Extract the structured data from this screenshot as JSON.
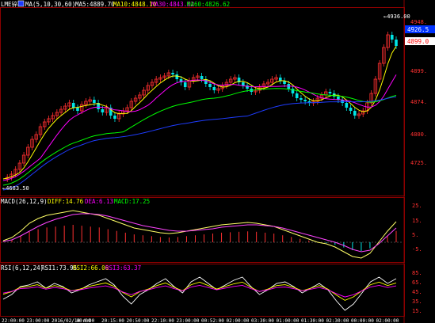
{
  "header": {
    "symbol": "LME锌",
    "ma_label": "MA(5,10,30,60)",
    "ma5": "MA5:4889.70",
    "ma10": "MA10:4848.10",
    "ma30": "MA30:4843.02",
    "ma60": "MA60:4826.62"
  },
  "price_panel": {
    "high_marker": "4936.00",
    "low_marker": "4683.50",
    "last_price_box": "4926.5",
    "ref_price_box": "4899.0",
    "axis_labels": [
      "4948.",
      "4899.",
      "4874.",
      "4800.",
      "4725."
    ]
  },
  "macd_panel": {
    "title": "MACD(26,12,9)",
    "diff": "DIFF:14.76",
    "dea": "DEA:6.13",
    "macd": "MACD:17.25",
    "axis_labels": [
      "25.",
      "15.",
      "5.",
      "-5."
    ]
  },
  "rsi_panel": {
    "title": "RSI(6,12,24)",
    "rsi1": "RSI1:73.95",
    "rsi2": "RSI2:66.06",
    "rsi3": "RSI3:63.37",
    "axis_labels": [
      "85.",
      "65.",
      "45.",
      "35.",
      "15."
    ]
  },
  "time_axis": {
    "labels": [
      "22:00:00",
      "23:00:00",
      "2016/02/14 4:00",
      "00:00",
      "20:15:00",
      "20:50:00",
      "22:10:00",
      "23:00:00",
      "00:52:00",
      "02:00:00",
      "03:30:00",
      "01:00:00",
      "01:30:00",
      "02:30:00",
      "00:00:00",
      "02:00:00"
    ]
  },
  "colors": {
    "background": "#000000",
    "up_candle": "#ff3030",
    "down_candle": "#00e5e5",
    "ma5": "#ffffff",
    "ma10": "#ffff00",
    "ma30": "#ff00ff",
    "ma60": "#00ff00",
    "ma_long": "#1e3cff",
    "diff_line": "#ffff66",
    "dea_line": "#ff44ff",
    "grid": "#8b0000"
  }
}
